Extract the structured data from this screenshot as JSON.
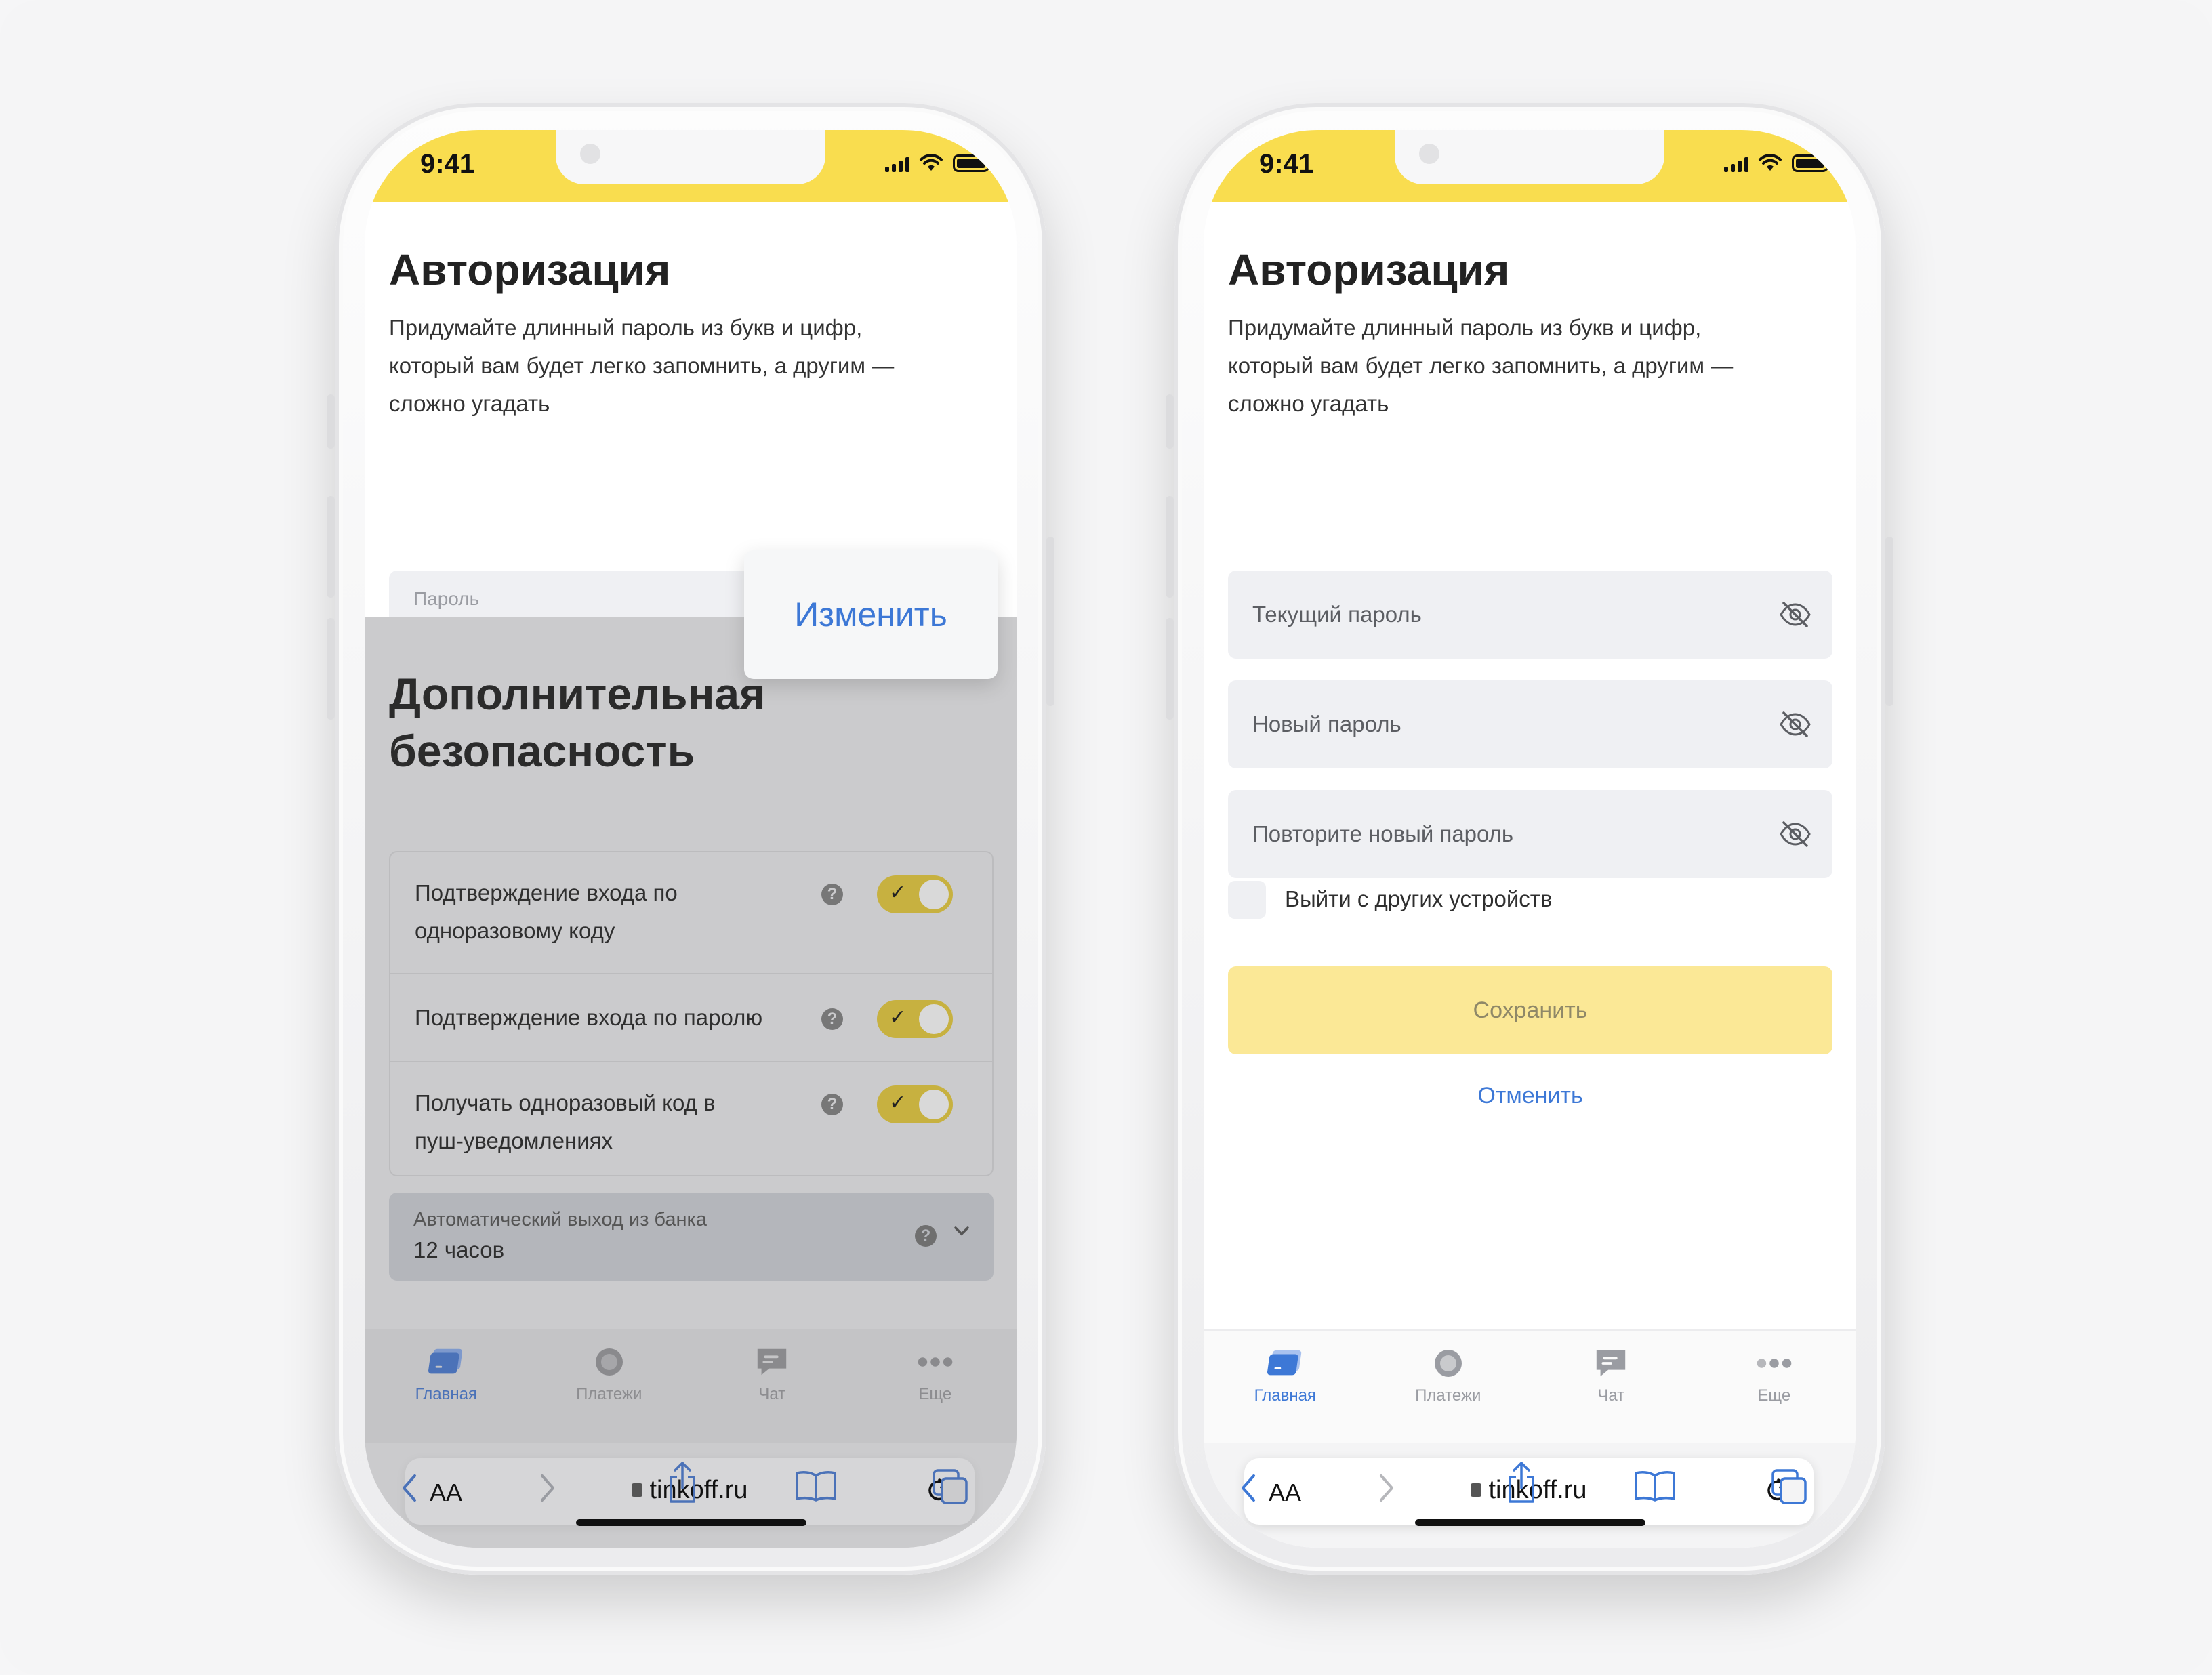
{
  "status": {
    "time": "9:41"
  },
  "auth": {
    "title": "Авторизация",
    "description_lines": [
      "Придумайте длинный пароль из букв и цифр,",
      "который вам будет легко запомнить, а другим —",
      "сложно угадать"
    ]
  },
  "left": {
    "password_label": "Пароль",
    "password_value": "••••••",
    "change_button": "Изменить",
    "security_title_lines": [
      "Дополнительная",
      "безопасность"
    ],
    "settings": [
      {
        "lines": [
          "Подтверждение входа по",
          "одноразовому коду"
        ],
        "enabled": true,
        "help": "?"
      },
      {
        "lines": [
          "Подтверждение входа по паролю"
        ],
        "enabled": true,
        "help": "?"
      },
      {
        "lines": [
          "Получать одноразовый код в",
          "пуш-уведомлениях"
        ],
        "enabled": true,
        "help": "?"
      }
    ],
    "auto_exit": {
      "label": "Автоматический выход из банка",
      "value": "12 часов",
      "help": "?"
    }
  },
  "right": {
    "fields": [
      {
        "placeholder": "Текущий пароль",
        "icon": "eye-off-icon"
      },
      {
        "placeholder": "Новый пароль",
        "icon": "eye-off-icon"
      },
      {
        "placeholder": "Повторите новый пароль",
        "icon": "eye-off-icon"
      }
    ],
    "logout_others_label": "Выйти с других устройств",
    "logout_others_checked": false,
    "save_button": "Сохранить",
    "cancel_link": "Отменить"
  },
  "tabbar": {
    "tabs": [
      {
        "label": "Главная",
        "icon": "card-icon",
        "active": true
      },
      {
        "label": "Платежи",
        "icon": "circle-icon",
        "active": false
      },
      {
        "label": "Чат",
        "icon": "chat-icon",
        "active": false
      },
      {
        "label": "Еще",
        "icon": "more-icon",
        "active": false
      }
    ]
  },
  "browser": {
    "text_size_label": "AA",
    "url": "tinkoff.ru",
    "icons": [
      "back-icon",
      "forward-icon",
      "share-icon",
      "bookmarks-icon",
      "tabs-icon"
    ]
  },
  "colors": {
    "brand_yellow": "#f9dd4f",
    "link_blue": "#3d78d6",
    "toggle_on_dimmed": "#c7b140",
    "save_disabled": "#fbe896",
    "field_bg": "#eff0f3"
  }
}
